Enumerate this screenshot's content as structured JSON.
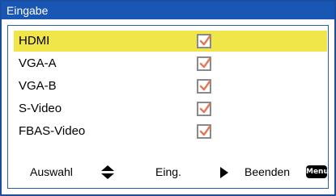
{
  "window": {
    "title": "Eingabe"
  },
  "inputs": [
    {
      "label": "HDMI",
      "checked": true,
      "selected": true
    },
    {
      "label": "VGA-A",
      "checked": true,
      "selected": false
    },
    {
      "label": "VGA-B",
      "checked": true,
      "selected": false
    },
    {
      "label": "S-Video",
      "checked": true,
      "selected": false
    },
    {
      "label": "FBAS-Video",
      "checked": true,
      "selected": false
    }
  ],
  "footer": {
    "select_label": "Auswahl",
    "enter_label": "Eing.",
    "exit_label": "Beenden",
    "menu_key_label": "Menu"
  },
  "colors": {
    "titlebar": "#1a56b4",
    "highlight": "#f0e64a",
    "checkmark": "#e07a55"
  }
}
